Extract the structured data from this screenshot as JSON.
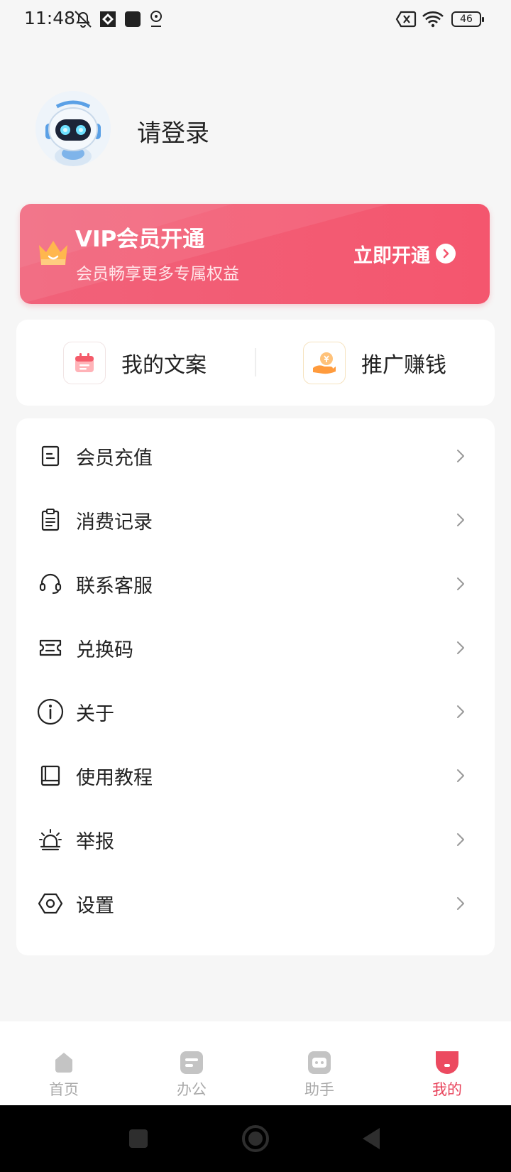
{
  "status_bar": {
    "time": "11:48",
    "battery": "46"
  },
  "profile": {
    "login_prompt": "请登录"
  },
  "vip": {
    "title": "VIP会员开通",
    "subtitle": "会员畅享更多专属权益",
    "cta": "立即开通",
    "accent": "#f4566e"
  },
  "quick_actions": [
    {
      "label": "我的文案",
      "icon": "calendar-icon"
    },
    {
      "label": "推广赚钱",
      "icon": "hand-coin-icon"
    }
  ],
  "menu": [
    {
      "label": "会员充值",
      "icon": "document-icon"
    },
    {
      "label": "消费记录",
      "icon": "clipboard-icon"
    },
    {
      "label": "联系客服",
      "icon": "headset-icon"
    },
    {
      "label": "兑换码",
      "icon": "ticket-icon"
    },
    {
      "label": "关于",
      "icon": "info-icon"
    },
    {
      "label": "使用教程",
      "icon": "book-icon"
    },
    {
      "label": "举报",
      "icon": "alarm-icon"
    },
    {
      "label": "设置",
      "icon": "settings-hexagon-icon"
    }
  ],
  "tabs": [
    {
      "label": "首页",
      "icon": "home-icon",
      "active": false
    },
    {
      "label": "办公",
      "icon": "office-icon",
      "active": false
    },
    {
      "label": "助手",
      "icon": "assistant-icon",
      "active": false
    },
    {
      "label": "我的",
      "icon": "profile-icon",
      "active": true
    }
  ],
  "colors": {
    "active_tab": "#e8425a",
    "inactive_tab": "#aaaaaa",
    "background": "#f6f6f6"
  }
}
